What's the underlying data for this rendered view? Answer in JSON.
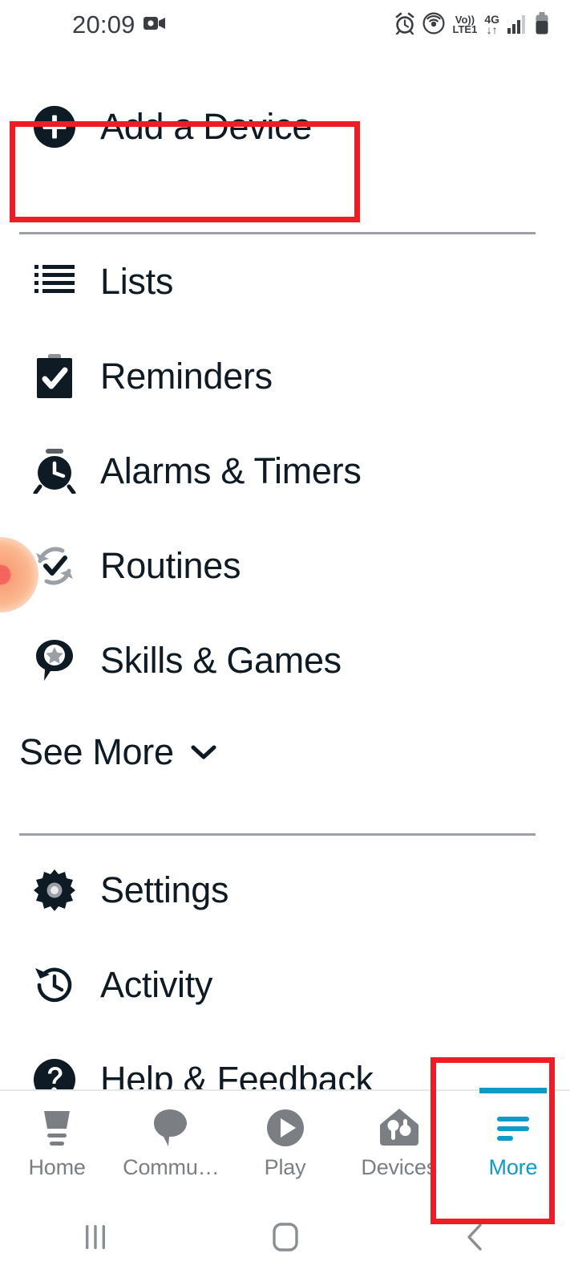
{
  "status_bar": {
    "time": "20:09",
    "left_icons": [
      "video-camera-icon"
    ],
    "volte_top": "Vo))",
    "volte_bottom": "LTE1",
    "network_type": "4G",
    "network_arrows": "↓↑",
    "right_icons": [
      "alarm-icon",
      "hotspot-icon",
      "volte-icon",
      "4g-data-icon",
      "signal-bars-icon",
      "battery-icon"
    ]
  },
  "menu": {
    "add_device": {
      "label": "Add a Device",
      "icon": "plus-circle-icon"
    },
    "items": [
      {
        "label": "Lists",
        "icon": "list-icon"
      },
      {
        "label": "Reminders",
        "icon": "clipboard-check-icon"
      },
      {
        "label": "Alarms & Timers",
        "icon": "alarm-clock-icon"
      },
      {
        "label": "Routines",
        "icon": "routines-refresh-check-icon"
      },
      {
        "label": "Skills & Games",
        "icon": "speech-bubble-star-icon"
      }
    ],
    "see_more": {
      "label": "See More",
      "icon": "chevron-down-icon"
    },
    "secondary_items": [
      {
        "label": "Settings",
        "icon": "gear-icon"
      },
      {
        "label": "Activity",
        "icon": "history-clock-icon"
      },
      {
        "label": "Help & Feedback",
        "icon": "question-circle-icon"
      }
    ]
  },
  "tab_bar": {
    "active": "More",
    "accent_color": "#0f9ac8",
    "inactive_color": "#7b7f83",
    "tabs": [
      {
        "label": "Home",
        "icon": "echo-device-icon",
        "active": false
      },
      {
        "label": "Commu…",
        "icon": "speech-bubble-icon",
        "active": false
      },
      {
        "label": "Play",
        "icon": "play-circle-icon",
        "active": false
      },
      {
        "label": "Devices",
        "icon": "home-devices-icon",
        "active": false
      },
      {
        "label": "More",
        "icon": "hamburger-menu-icon",
        "active": true
      }
    ]
  },
  "system_nav": {
    "recents": "recents-icon",
    "home": "home-square-icon",
    "back": "back-chevron-icon"
  },
  "annotations": {
    "color": "#ee1c25",
    "boxes": [
      {
        "name": "add-a-device-highlight"
      },
      {
        "name": "more-tab-highlight"
      }
    ]
  },
  "touch_indicator": {
    "name": "tap-indicator",
    "color": "#f3655d"
  }
}
